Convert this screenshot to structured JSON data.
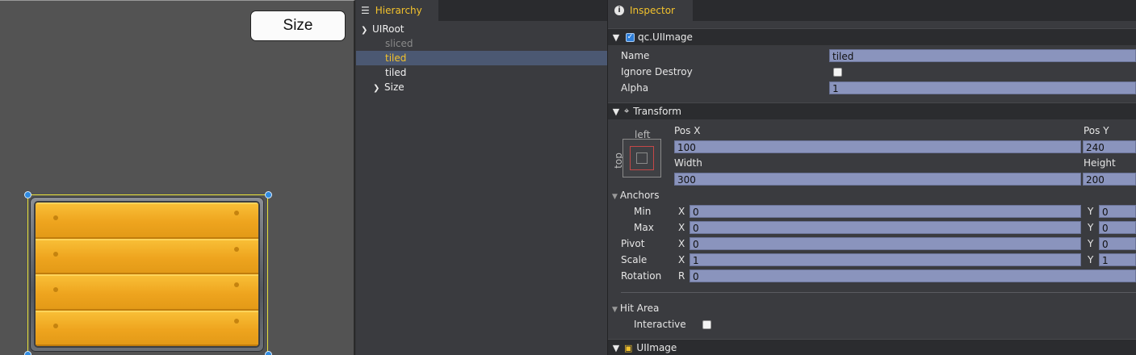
{
  "scene": {
    "size_button_label": "Size"
  },
  "hierarchy": {
    "tab_label": "Hierarchy",
    "tab_icon": "list-icon",
    "items": [
      {
        "label": "UIRoot",
        "state": "expanded"
      },
      {
        "label": "sliced",
        "state": "disabled"
      },
      {
        "label": "tiled",
        "state": "selected"
      },
      {
        "label": "tiled",
        "state": "normal"
      },
      {
        "label": "Size",
        "state": "collapsed"
      }
    ]
  },
  "inspector": {
    "tab_label": "Inspector",
    "tab_icon": "info-icon",
    "component": {
      "title": "qc.UIImage",
      "name_label": "Name",
      "name_value": "tiled",
      "ignore_destroy_label": "Ignore Destroy",
      "alpha_label": "Alpha",
      "alpha_value": "1"
    },
    "transform": {
      "title": "Transform",
      "anchor_left_label": "left",
      "anchor_top_label": "top",
      "pos_x_label": "Pos X",
      "pos_x_value": "100",
      "pos_y_label": "Pos Y",
      "pos_y_value": "240",
      "width_label": "Width",
      "width_value": "300",
      "height_label": "Height",
      "height_value": "200",
      "anchors_label": "Anchors",
      "min_label": "Min",
      "min_x": "0",
      "min_y": "0",
      "max_label": "Max",
      "max_x": "0",
      "max_y": "0",
      "pivot_label": "Pivot",
      "pivot_x": "0",
      "pivot_y": "0",
      "scale_label": "Scale",
      "scale_x": "1",
      "scale_y": "1",
      "rotation_label": "Rotation",
      "rotation_value": "0",
      "x_letter": "X",
      "y_letter": "Y",
      "r_letter": "R",
      "hit_area_label": "Hit Area",
      "interactive_label": "Interactive"
    },
    "uiimage_title": "UIImage"
  }
}
